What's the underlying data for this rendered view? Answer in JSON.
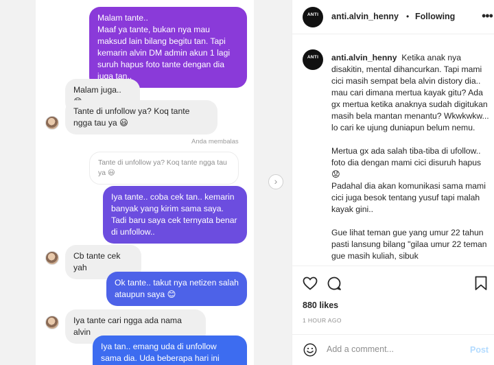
{
  "chat": {
    "messages": [
      {
        "text": "Malam tante..\nMaaf ya tante, bukan nya mau maksud lain bilang begitu tan. Tapi kemarin alvin DM admin akun 1 lagi suruh hapus foto tante dengan dia juga tan..",
        "color": "#8a3ad9"
      },
      {
        "text": "Malam juga.. 😊"
      },
      {
        "text": "Tante di unfollow ya? Koq tante ngga tau ya 😃"
      },
      {
        "text": "Anda membalas"
      },
      {
        "text": "Tante di unfollow ya? Koq tante ngga tau ya 😃"
      },
      {
        "text": "Iya tante.. coba cek tan.. kemarin banyak yang kirim sama saya. Tadi baru saya cek ternyata benar di unfollow..",
        "color": "#6c4ddf"
      },
      {
        "text": "Cb tante cek yah"
      },
      {
        "text": "Ok tante.. takut nya netizen salah ataupun saya 😊",
        "color": "#4d62e8"
      },
      {
        "text": "Iya tante cari ngga ada nama alvin"
      },
      {
        "text": "Iya tan.. emang uda di unfollow sama dia. Uda beberapa hari ini netizen",
        "color": "#3d6cf0"
      }
    ],
    "next_icon": "chevron-right-icon"
  },
  "post": {
    "logo_text": "ANTI",
    "username": "anti.alvin_henny",
    "separator": "•",
    "following_label": "Following",
    "more_icon": "more-options-icon",
    "caption": "Ketika anak nya disakitin, mental dihancurkan. Tapi mami cici masih sempat bela alvin distory dia.. mau cari dimana mertua kayak gitu? Ada gx mertua ketika anaknya sudah digitukan masih bela mantan menantu? Wkwkwkw... lo cari ke ujung duniapun belum nemu.\n\nMertua gx ada salah tiba-tiba di ufollow.. foto dia dengan mami cici disuruh hapus 😟\nPadahal dia akan komunikasi sama mami cici juga besok tentang yusuf tapi malah kayak gini..\n\nGue lihat teman gue yang umur 22 tahun pasti lansung bilang \"gilaa umur 22 teman gue masih kuliah, sibuk",
    "likes": "880 likes",
    "time": "1 HOUR AGO",
    "comment_placeholder": "Add a comment...",
    "post_label": "Post",
    "icons": {
      "like": "heart-icon",
      "comment": "comment-icon",
      "save": "bookmark-icon",
      "emoji": "emoji-icon"
    }
  }
}
